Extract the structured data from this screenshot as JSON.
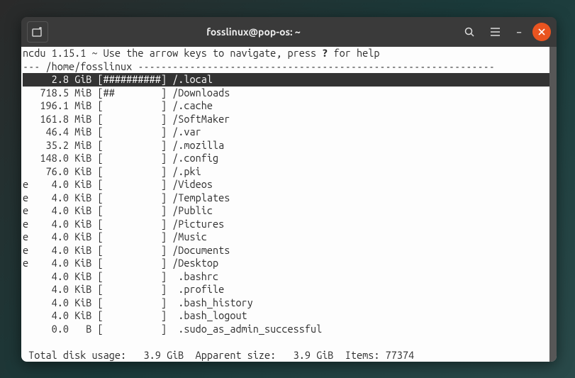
{
  "titlebar": {
    "title": "fosslinux@pop-os: ~"
  },
  "ncdu": {
    "header_pre": "ncdu 1.15.1 ~ Use the arrow keys to navigate, press ",
    "header_q": "?",
    "header_post": " for help",
    "path_line": "--- /home/fosslinux --------------------------------------------------------------",
    "rows": [
      {
        "flag": " ",
        "size": "   2.8 GiB",
        "bar": "[##########]",
        "name": "/.local",
        "selected": true
      },
      {
        "flag": " ",
        "size": " 718.5 MiB",
        "bar": "[##        ]",
        "name": "/Downloads"
      },
      {
        "flag": " ",
        "size": " 196.1 MiB",
        "bar": "[          ]",
        "name": "/.cache"
      },
      {
        "flag": " ",
        "size": " 161.8 MiB",
        "bar": "[          ]",
        "name": "/SoftMaker"
      },
      {
        "flag": " ",
        "size": "  46.4 MiB",
        "bar": "[          ]",
        "name": "/.var"
      },
      {
        "flag": " ",
        "size": "  35.2 MiB",
        "bar": "[          ]",
        "name": "/.mozilla"
      },
      {
        "flag": " ",
        "size": " 148.0 KiB",
        "bar": "[          ]",
        "name": "/.config"
      },
      {
        "flag": " ",
        "size": "  76.0 KiB",
        "bar": "[          ]",
        "name": "/.pki"
      },
      {
        "flag": "e",
        "size": "   4.0 KiB",
        "bar": "[          ]",
        "name": "/Videos"
      },
      {
        "flag": "e",
        "size": "   4.0 KiB",
        "bar": "[          ]",
        "name": "/Templates"
      },
      {
        "flag": "e",
        "size": "   4.0 KiB",
        "bar": "[          ]",
        "name": "/Public"
      },
      {
        "flag": "e",
        "size": "   4.0 KiB",
        "bar": "[          ]",
        "name": "/Pictures"
      },
      {
        "flag": "e",
        "size": "   4.0 KiB",
        "bar": "[          ]",
        "name": "/Music"
      },
      {
        "flag": "e",
        "size": "   4.0 KiB",
        "bar": "[          ]",
        "name": "/Documents"
      },
      {
        "flag": "e",
        "size": "   4.0 KiB",
        "bar": "[          ]",
        "name": "/Desktop"
      },
      {
        "flag": " ",
        "size": "   4.0 KiB",
        "bar": "[          ]",
        "name": " .bashrc"
      },
      {
        "flag": " ",
        "size": "   4.0 KiB",
        "bar": "[          ]",
        "name": " .profile"
      },
      {
        "flag": " ",
        "size": "   4.0 KiB",
        "bar": "[          ]",
        "name": " .bash_history"
      },
      {
        "flag": " ",
        "size": "   4.0 KiB",
        "bar": "[          ]",
        "name": " .bash_logout"
      },
      {
        "flag": " ",
        "size": "   0.0   B",
        "bar": "[          ]",
        "name": " .sudo_as_admin_successful"
      }
    ],
    "status": " Total disk usage:   3.9 GiB  Apparent size:   3.9 GiB  Items: 77374"
  }
}
